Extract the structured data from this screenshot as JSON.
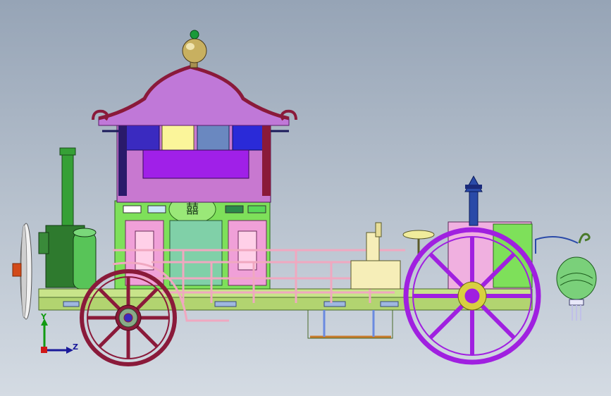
{
  "viewport": {
    "background_top": "#96a4b6",
    "background_bottom": "#d4dbe3"
  },
  "triad": {
    "y_label": "Y",
    "z_label": "Z",
    "y_color": "#129a12",
    "z_color": "#1a1a9a",
    "x_color": "#d01818"
  },
  "model": {
    "roof_color": "#c078d8",
    "roof_trim_color": "#8a1a3a",
    "cabin_color": "#c878d0",
    "base_color": "#7ee05a",
    "chassis_color": "#b9e07a",
    "rear_wheel_color": "#8a1a3a",
    "front_wheel_color": "#a020e0",
    "boiler_color": "#2e7a2e",
    "lantern_color": "#7ad07a",
    "finial_color": "#c8b060"
  }
}
